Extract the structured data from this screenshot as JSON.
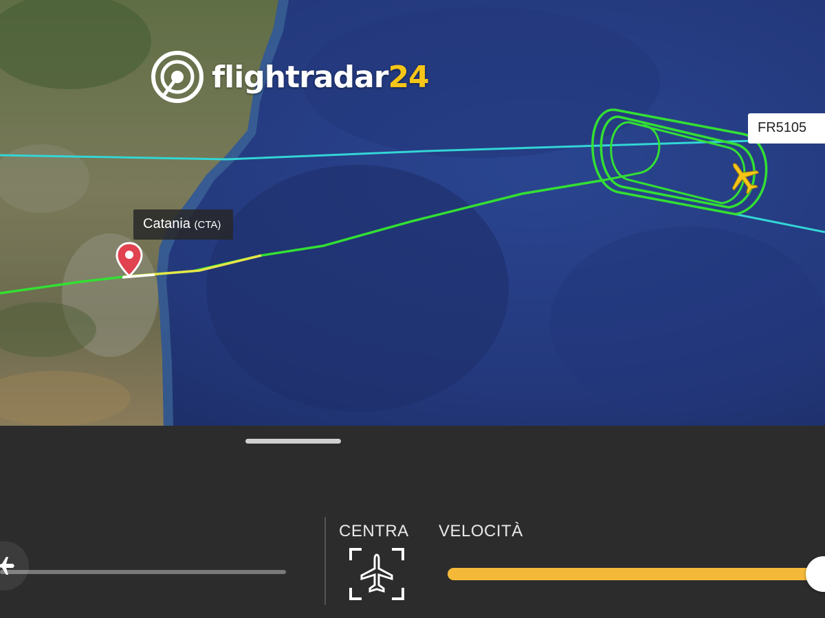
{
  "map": {
    "logo": {
      "text": "flightradar",
      "number": "24"
    },
    "airport": {
      "name": "Catania",
      "code": "(CTA)"
    },
    "flight": {
      "callsign": "FR5105"
    },
    "colors": {
      "sea": "#27418a",
      "land": "#6e7a52",
      "other_track": "#33d6d6",
      "flight_track": "#33e033",
      "plane": "#f5c518",
      "pin": "#e0424f"
    }
  },
  "panel": {
    "center_label": "CENTRA",
    "speed_label": "VELOCITÀ",
    "speed_level": 1.0,
    "timeline_level": 0.0,
    "colors": {
      "background": "#2c2c2c",
      "speed_fill": "#f5b93a"
    }
  }
}
